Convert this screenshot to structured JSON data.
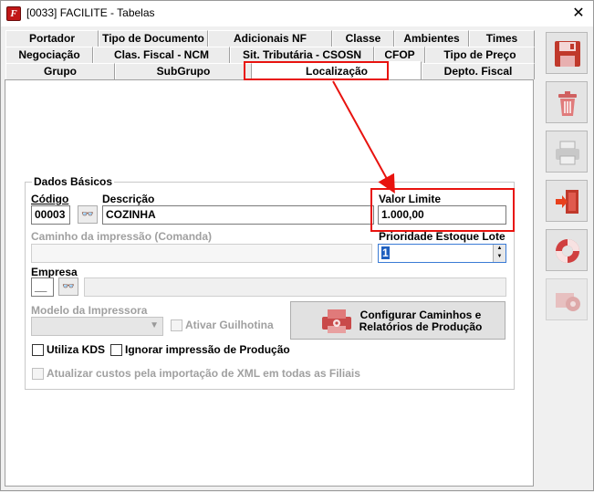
{
  "window": {
    "title": "[0033] FACILITE - Tabelas",
    "app_icon_letter": "F",
    "close_glyph": "✕"
  },
  "tabs": {
    "row1": [
      "Portador",
      "Tipo de Documento",
      "Adicionais NF",
      "Classe",
      "Ambientes",
      "Times"
    ],
    "row2": [
      "Negociação",
      "Clas. Fiscal - NCM",
      "Sit. Tributária - CSOSN",
      "CFOP",
      "Tipo de Preço"
    ],
    "row3": [
      "Grupo",
      "SubGrupo",
      "Localização",
      "Depto. Fiscal"
    ],
    "active": "Localização"
  },
  "form": {
    "group_title": "Dados Básicos",
    "codigo_label": "Código",
    "codigo_value": "00003",
    "descricao_label": "Descrição",
    "descricao_value": "COZINHA",
    "valor_limite_label": "Valor Limite",
    "valor_limite_value": "1.000,00",
    "caminho_label": "Caminho da impressão (Comanda)",
    "caminho_value": "",
    "prioridade_label": "Prioridade Estoque Lote",
    "prioridade_value": "1",
    "empresa_label": "Empresa",
    "empresa_value": "__",
    "empresa_nome": "",
    "modelo_label": "Modelo da Impressora",
    "modelo_value": "",
    "ativar_guilhotina_label": "Ativar Guilhotina",
    "configurar_button_label": "Configurar Caminhos e Relatórios de Produção",
    "utiliza_kds_label": "Utiliza KDS",
    "ignorar_impressao_label": "Ignorar impressão de Produção",
    "atualizar_custos_label": "Atualizar custos pela importação de XML em todas as Filiais",
    "binoculars_glyph": "👓"
  },
  "sidebar": {
    "buttons": [
      "save-icon",
      "trash-icon",
      "printer-icon",
      "exit-door-icon",
      "lifebuoy-icon",
      "settings-gear-icon"
    ]
  },
  "colors": {
    "highlight": "#e8130f",
    "accent_red": "#c0392b"
  }
}
